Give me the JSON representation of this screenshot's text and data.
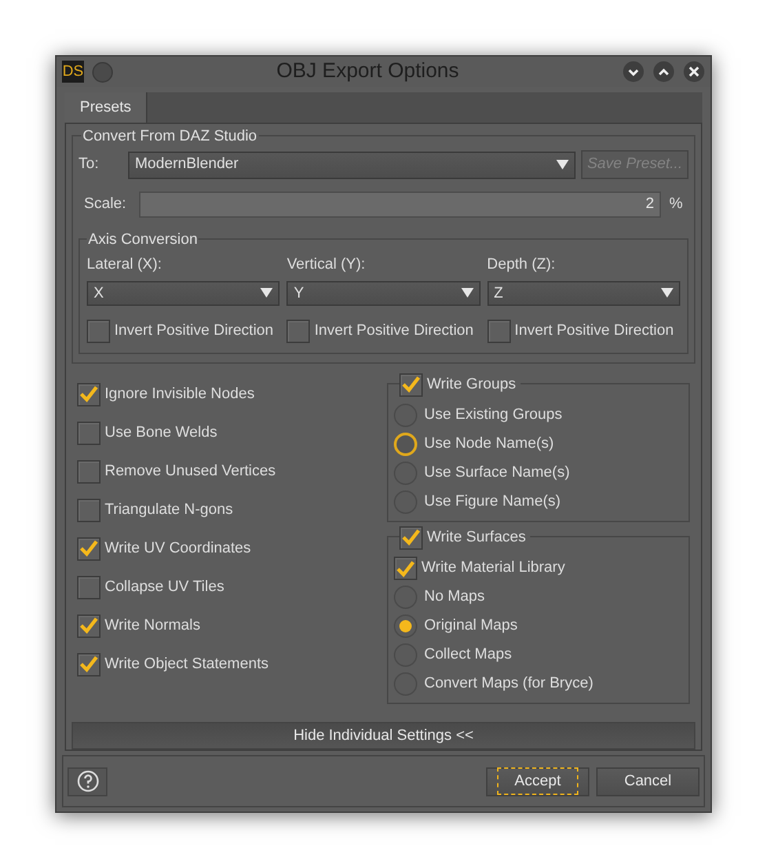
{
  "window": {
    "title": "OBJ Export Options",
    "logo": "DS"
  },
  "tabs": [
    {
      "label": "Presets",
      "selected": true
    }
  ],
  "convert": {
    "title": "Convert From DAZ Studio",
    "to_label": "To:",
    "to_value": "ModernBlender",
    "save_preset": {
      "label": "Save Preset...",
      "disabled": true
    },
    "scale_label": "Scale:",
    "scale_value": "2",
    "scale_unit": "%"
  },
  "axis": {
    "title": "Axis Conversion",
    "columns": [
      {
        "label": "Lateral (X):",
        "value": "X",
        "invert": {
          "label": "Invert Positive Direction",
          "checked": false
        }
      },
      {
        "label": "Vertical (Y):",
        "value": "Y",
        "invert": {
          "label": "Invert Positive Direction",
          "checked": false
        }
      },
      {
        "label": "Depth (Z):",
        "value": "Z",
        "invert": {
          "label": "Invert Positive Direction",
          "checked": false
        }
      }
    ]
  },
  "options": [
    {
      "label": "Ignore Invisible Nodes",
      "checked": true
    },
    {
      "label": "Use Bone Welds",
      "checked": false
    },
    {
      "label": "Remove Unused Vertices",
      "checked": false
    },
    {
      "label": "Triangulate N-gons",
      "checked": false
    },
    {
      "label": "Write UV Coordinates",
      "checked": true
    },
    {
      "label": "Collapse UV Tiles",
      "checked": false
    },
    {
      "label": "Write Normals",
      "checked": true
    },
    {
      "label": "Write Object Statements",
      "checked": true
    }
  ],
  "write_groups": {
    "label": "Write Groups",
    "checked": true,
    "items": [
      {
        "kind": "radio",
        "label": "Use Existing Groups",
        "selected": false,
        "hovered": false
      },
      {
        "kind": "radio",
        "label": "Use Node Name(s)",
        "selected": false,
        "hovered": true
      },
      {
        "kind": "radio",
        "label": "Use Surface Name(s)",
        "selected": false,
        "hovered": false
      },
      {
        "kind": "radio",
        "label": "Use Figure Name(s)",
        "selected": false,
        "hovered": false
      }
    ]
  },
  "write_surfaces": {
    "label": "Write Surfaces",
    "checked": true,
    "items": [
      {
        "kind": "checkbox",
        "label": "Write Material Library",
        "checked": true
      },
      {
        "kind": "radio",
        "label": "No Maps",
        "selected": false,
        "hovered": false
      },
      {
        "kind": "radio",
        "label": "Original Maps",
        "selected": true,
        "hovered": false
      },
      {
        "kind": "radio",
        "label": "Collect Maps",
        "selected": false,
        "hovered": false
      },
      {
        "kind": "radio",
        "label": "Convert Maps (for Bryce)",
        "selected": false,
        "hovered": false
      }
    ]
  },
  "toggle_settings": "Hide Individual Settings <<",
  "buttons": [
    {
      "label": "Accept",
      "focused": true
    },
    {
      "label": "Cancel",
      "focused": false
    }
  ]
}
